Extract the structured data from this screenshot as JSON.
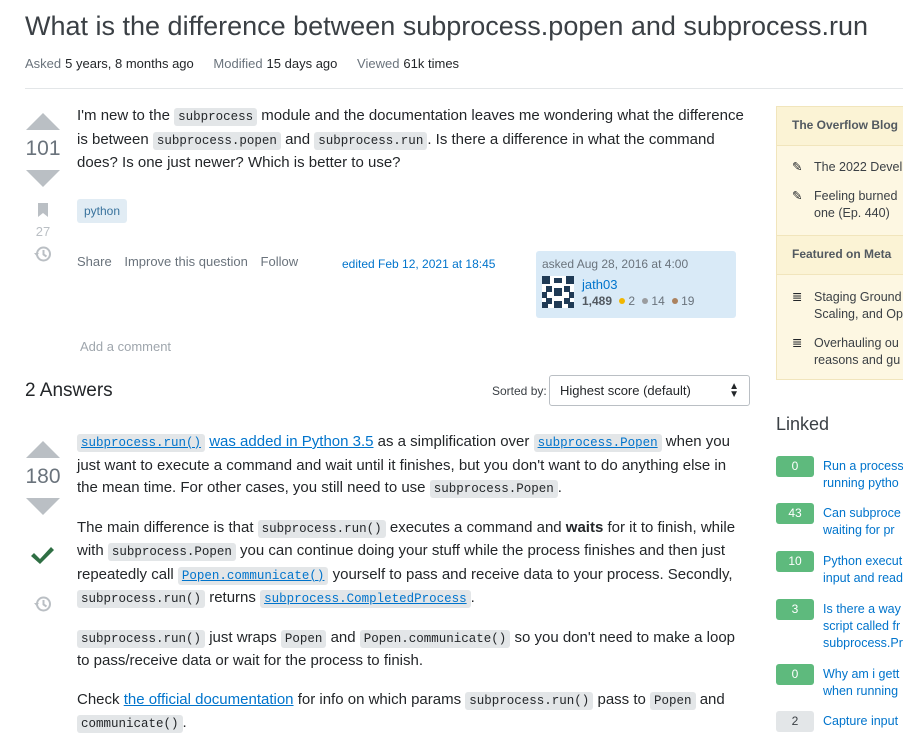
{
  "question": {
    "title": "What is the difference between subprocess.popen and subprocess.run",
    "meta": {
      "asked_label": "Asked",
      "asked_value": "5 years, 8 months ago",
      "modified_label": "Modified",
      "modified_value": "15 days ago",
      "viewed_label": "Viewed",
      "viewed_value": "61k times"
    },
    "score": "101",
    "bookmark_count": "27",
    "body": {
      "t1": "I'm new to the ",
      "c1": "subprocess",
      "t2": " module and the documentation leaves me wondering what the difference is between ",
      "c2": "subprocess.popen",
      "t3": " and ",
      "c3": "subprocess.run",
      "t4": ". Is there a difference in what the command does? Is one just newer? Which is better to use?"
    },
    "tag": "python",
    "actions": {
      "share": "Share",
      "improve": "Improve this question",
      "follow": "Follow"
    },
    "edited": "edited Feb 12, 2021 at 18:45",
    "user_card": {
      "asked": "asked Aug 28, 2016 at 4:00",
      "username": "jath03",
      "reputation": "1,489",
      "gold": "",
      "silver": "2",
      "bronze": "14",
      "bronze2": "19"
    },
    "add_comment": "Add a comment"
  },
  "answers": {
    "heading": "2 Answers",
    "sorted_label": "Sorted by:",
    "sort_value": "Highest score (default)",
    "top": {
      "score": "180",
      "p1": {
        "c1": "subprocess.run()",
        "link1": "was added in Python 3.5",
        "t1": " as a simplification over ",
        "c2": "subprocess.Popen",
        "t2": " when you just want to execute a command and wait until it finishes, but you don't want to do anything else in the mean time. For other cases, you still need to use ",
        "c3": "subprocess.Popen",
        "t3": "."
      },
      "p2": {
        "t1": "The main difference is that ",
        "c1": "subprocess.run()",
        "t2": " executes a command and ",
        "b1": "waits",
        "t3": " for it to finish, while with ",
        "c2": "subprocess.Popen",
        "t4": " you can continue doing your stuff while the process finishes and then just repeatedly call ",
        "c3": "Popen.communicate()",
        "t5": " yourself to pass and receive data to your process. Secondly, ",
        "c4": "subprocess.run()",
        "t6": " returns ",
        "c5": "subprocess.CompletedProcess",
        "t7": "."
      },
      "p3": {
        "c1": "subprocess.run()",
        "t1": " just wraps ",
        "c2": "Popen",
        "t2": " and ",
        "c3": "Popen.communicate()",
        "t3": " so you don't need to make a loop to pass/receive data or wait for the process to finish."
      },
      "p4": {
        "t1": "Check ",
        "link1": "the official documentation",
        "t2": " for info on which params ",
        "c1": "subprocess.run()",
        "t3": " pass to ",
        "c2": "Popen",
        "t4": " and ",
        "c3": "communicate()",
        "t5": "."
      }
    }
  },
  "sidebar": {
    "blog_heading": "The Overflow Blog",
    "blog_items": [
      {
        "icon": "pencil-icon",
        "text": "The 2022 Devel"
      },
      {
        "icon": "pencil-icon",
        "text": "Feeling burned",
        "text2": "one (Ep. 440)"
      }
    ],
    "meta_heading": "Featured on Meta",
    "meta_items": [
      {
        "icon": "stackexchange-icon",
        "text": "Staging Ground",
        "text2": "Scaling, and Op"
      },
      {
        "icon": "stackexchange-icon",
        "text": "Overhauling ou",
        "text2": "reasons and gu"
      }
    ],
    "linked_heading": "Linked",
    "linked": [
      {
        "count": "0",
        "answered": true,
        "line1": "Run a process",
        "line2": "running pytho"
      },
      {
        "count": "43",
        "answered": true,
        "line1": "Can subproce",
        "line2": "waiting for pr"
      },
      {
        "count": "10",
        "answered": true,
        "line1": "Python execut",
        "line2": "input and read"
      },
      {
        "count": "3",
        "answered": true,
        "line1": "Is there a way",
        "line2": "script called fr",
        "line3": "subprocess.Pr"
      },
      {
        "count": "0",
        "answered": true,
        "line1": "Why am i gett",
        "line2": "when running"
      },
      {
        "count": "2",
        "answered": false,
        "line1": "Capture input"
      }
    ]
  }
}
